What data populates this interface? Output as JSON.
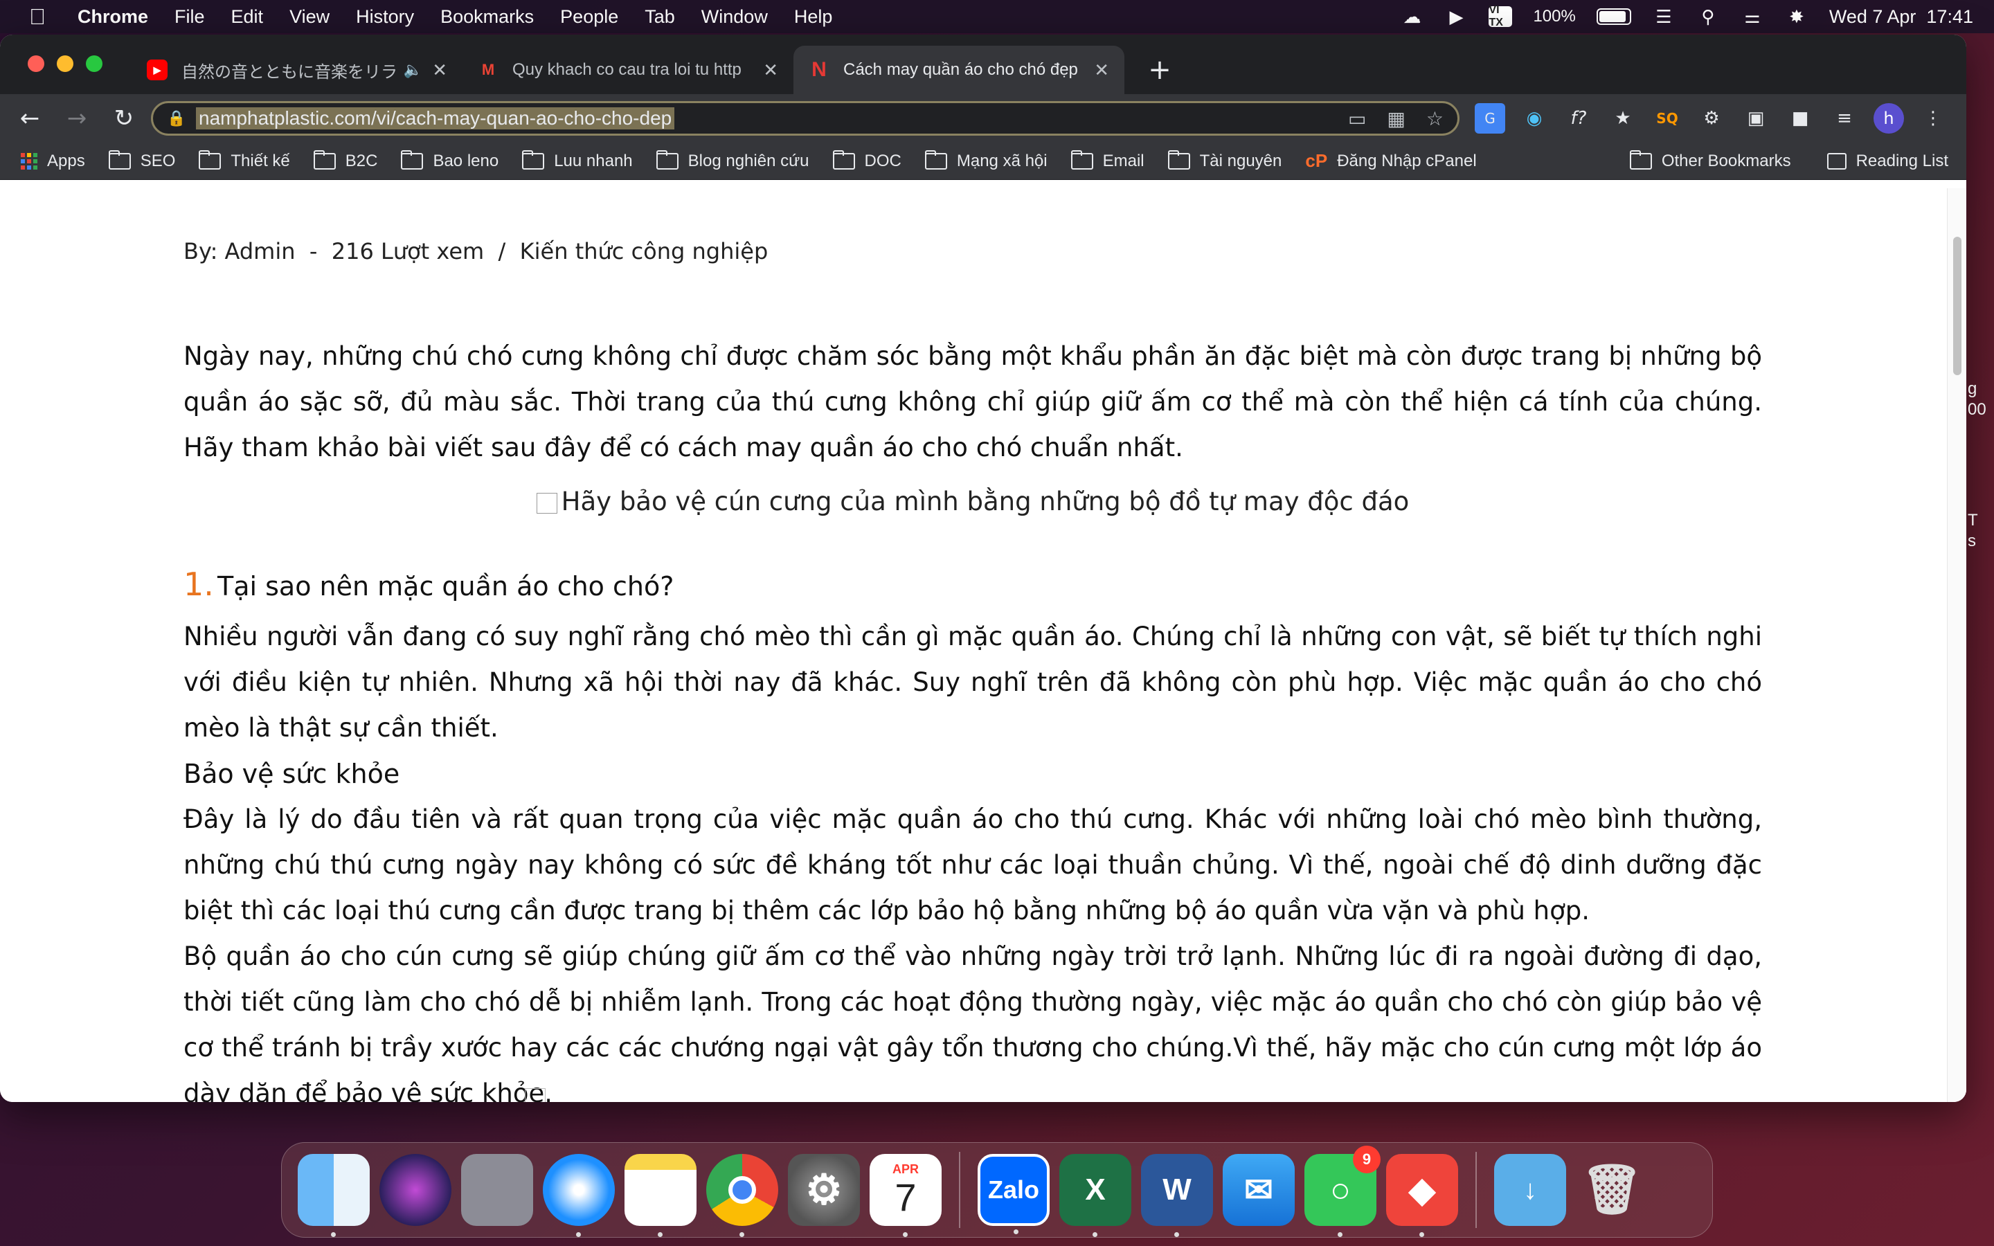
{
  "menubar": {
    "app": "Chrome",
    "items": [
      "File",
      "Edit",
      "View",
      "History",
      "Bookmarks",
      "People",
      "Tab",
      "Window",
      "Help"
    ],
    "vtx_label": "VI TX",
    "battery": "100%",
    "datetime": "Wed 7 Apr  17:41"
  },
  "tabs": [
    {
      "title": "自然の音とともに音楽をリラ",
      "active": false
    },
    {
      "title": "Quy khach co cau tra loi tu http",
      "active": false
    },
    {
      "title": "Cách may quần áo cho chó đẹp",
      "active": true
    }
  ],
  "toolbar": {
    "url": "namphatplastic.com/vi/cach-may-quan-ao-cho-cho-dep",
    "avatar_letter": "h"
  },
  "bookmarks": {
    "items": [
      "Apps",
      "SEO",
      "Thiết kế",
      "B2C",
      "Bao leno",
      "Luu nhanh",
      "Blog nghiên cứu",
      "DOC",
      "Mạng xã hội",
      "Email",
      "Tài nguyên",
      "Đăng Nhập cPanel"
    ],
    "other": "Other Bookmarks",
    "reading": "Reading List"
  },
  "article": {
    "meta": "By: Admin  -  216 Lượt xem  /  Kiến thức công nghiệp",
    "intro": "Ngày nay, những chú chó cưng không chỉ được chăm sóc bằng một khẩu phần ăn đặc biệt mà còn được trang bị những bộ quần áo sặc sỡ, đủ màu sắc. Thời trang của thú cưng không chỉ giúp giữ ấm cơ thể mà còn thể hiện cá tính của chúng. Hãy tham khảo bài viết sau đây để có cách may quần áo cho chó chuẩn nhất.",
    "image_alt": "Hãy bảo vệ cún cưng của mình bằng những bộ đồ tự may độc đáo",
    "section_num": "1.",
    "section_title": "Tại sao nên mặc quần áo cho chó?",
    "para1": "Nhiều người vẫn đang có suy nghĩ rằng chó mèo thì cần gì mặc quần áo. Chúng chỉ là những con vật, sẽ biết tự thích nghi với điều kiện tự nhiên. Nhưng xã hội thời nay đã khác. Suy nghĩ trên đã không còn phù hợp. Việc mặc quần áo cho chó mèo là thật sự cần thiết.",
    "subhead": "Bảo vệ sức khỏe",
    "para2": "Đây là lý do đầu tiên và rất quan trọng của việc mặc quần áo cho thú cưng. Khác với những loài chó mèo bình thường, những chú thú cưng ngày nay không có sức đề kháng tốt như các loại thuần chủng. Vì thế, ngoài chế độ dinh dưỡng đặc biệt thì các loại thú cưng cần được trang bị thêm các lớp bảo hộ bằng những bộ áo quần vừa vặn và phù hợp.",
    "para3": "Bộ quần áo cho cún cưng sẽ giúp chúng giữ ấm cơ thể vào những ngày trời trở lạnh. Những lúc đi ra ngoài đường đi dạo, thời tiết cũng làm cho chó dễ bị nhiễm lạnh. Trong các hoạt động thường ngày, việc mặc áo quần cho chó còn giúp bảo vệ cơ thể tránh bị trầy xước hay các các chướng ngại vật gây tổn thương cho chúng.Vì thế, hãy mặc cho cún cưng một lớp áo dày dặn để bảo vệ sức khỏe."
  },
  "desktop_edge": [
    "g",
    "00",
    "T",
    "s"
  ],
  "dock": {
    "calendar_month": "APR",
    "calendar_day": "7",
    "zalo_label": "Zalo",
    "excel_letter": "X",
    "word_letter": "W",
    "messages_badge": "9"
  }
}
